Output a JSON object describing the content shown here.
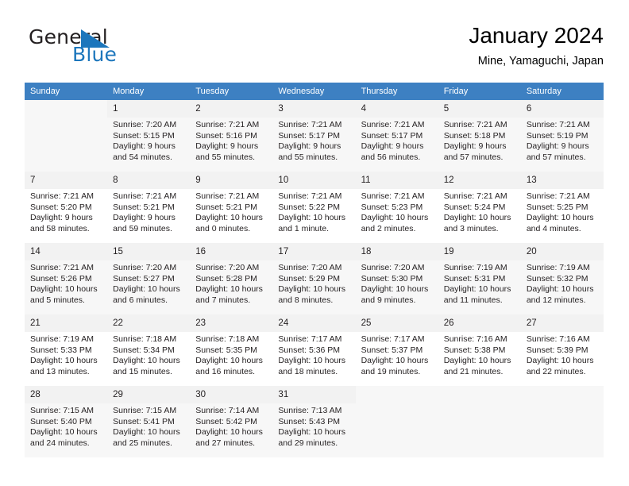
{
  "logo": {
    "primary_text": "General",
    "secondary_text": "Blue",
    "primary_color": "#231f20",
    "secondary_color": "#1c76bc",
    "mark": "triangle-icon"
  },
  "header": {
    "title": "January 2024",
    "subtitle": "Mine, Yamaguchi, Japan"
  },
  "theme": {
    "header_bg": "#3d80c2",
    "header_text": "#ffffff",
    "daynum_bg": "#f2f2f2",
    "row_shade_bg": "#f7f7f7",
    "text": "#231f20"
  },
  "calendar": {
    "weekday_headers": [
      "Sunday",
      "Monday",
      "Tuesday",
      "Wednesday",
      "Thursday",
      "Friday",
      "Saturday"
    ],
    "weeks": [
      [
        {
          "day": "",
          "sunrise": "",
          "sunset": "",
          "daylight": "",
          "daylight2": ""
        },
        {
          "day": "1",
          "sunrise": "Sunrise: 7:20 AM",
          "sunset": "Sunset: 5:15 PM",
          "daylight": "Daylight: 9 hours",
          "daylight2": "and 54 minutes."
        },
        {
          "day": "2",
          "sunrise": "Sunrise: 7:21 AM",
          "sunset": "Sunset: 5:16 PM",
          "daylight": "Daylight: 9 hours",
          "daylight2": "and 55 minutes."
        },
        {
          "day": "3",
          "sunrise": "Sunrise: 7:21 AM",
          "sunset": "Sunset: 5:17 PM",
          "daylight": "Daylight: 9 hours",
          "daylight2": "and 55 minutes."
        },
        {
          "day": "4",
          "sunrise": "Sunrise: 7:21 AM",
          "sunset": "Sunset: 5:17 PM",
          "daylight": "Daylight: 9 hours",
          "daylight2": "and 56 minutes."
        },
        {
          "day": "5",
          "sunrise": "Sunrise: 7:21 AM",
          "sunset": "Sunset: 5:18 PM",
          "daylight": "Daylight: 9 hours",
          "daylight2": "and 57 minutes."
        },
        {
          "day": "6",
          "sunrise": "Sunrise: 7:21 AM",
          "sunset": "Sunset: 5:19 PM",
          "daylight": "Daylight: 9 hours",
          "daylight2": "and 57 minutes."
        }
      ],
      [
        {
          "day": "7",
          "sunrise": "Sunrise: 7:21 AM",
          "sunset": "Sunset: 5:20 PM",
          "daylight": "Daylight: 9 hours",
          "daylight2": "and 58 minutes."
        },
        {
          "day": "8",
          "sunrise": "Sunrise: 7:21 AM",
          "sunset": "Sunset: 5:21 PM",
          "daylight": "Daylight: 9 hours",
          "daylight2": "and 59 minutes."
        },
        {
          "day": "9",
          "sunrise": "Sunrise: 7:21 AM",
          "sunset": "Sunset: 5:21 PM",
          "daylight": "Daylight: 10 hours",
          "daylight2": "and 0 minutes."
        },
        {
          "day": "10",
          "sunrise": "Sunrise: 7:21 AM",
          "sunset": "Sunset: 5:22 PM",
          "daylight": "Daylight: 10 hours",
          "daylight2": "and 1 minute."
        },
        {
          "day": "11",
          "sunrise": "Sunrise: 7:21 AM",
          "sunset": "Sunset: 5:23 PM",
          "daylight": "Daylight: 10 hours",
          "daylight2": "and 2 minutes."
        },
        {
          "day": "12",
          "sunrise": "Sunrise: 7:21 AM",
          "sunset": "Sunset: 5:24 PM",
          "daylight": "Daylight: 10 hours",
          "daylight2": "and 3 minutes."
        },
        {
          "day": "13",
          "sunrise": "Sunrise: 7:21 AM",
          "sunset": "Sunset: 5:25 PM",
          "daylight": "Daylight: 10 hours",
          "daylight2": "and 4 minutes."
        }
      ],
      [
        {
          "day": "14",
          "sunrise": "Sunrise: 7:21 AM",
          "sunset": "Sunset: 5:26 PM",
          "daylight": "Daylight: 10 hours",
          "daylight2": "and 5 minutes."
        },
        {
          "day": "15",
          "sunrise": "Sunrise: 7:20 AM",
          "sunset": "Sunset: 5:27 PM",
          "daylight": "Daylight: 10 hours",
          "daylight2": "and 6 minutes."
        },
        {
          "day": "16",
          "sunrise": "Sunrise: 7:20 AM",
          "sunset": "Sunset: 5:28 PM",
          "daylight": "Daylight: 10 hours",
          "daylight2": "and 7 minutes."
        },
        {
          "day": "17",
          "sunrise": "Sunrise: 7:20 AM",
          "sunset": "Sunset: 5:29 PM",
          "daylight": "Daylight: 10 hours",
          "daylight2": "and 8 minutes."
        },
        {
          "day": "18",
          "sunrise": "Sunrise: 7:20 AM",
          "sunset": "Sunset: 5:30 PM",
          "daylight": "Daylight: 10 hours",
          "daylight2": "and 9 minutes."
        },
        {
          "day": "19",
          "sunrise": "Sunrise: 7:19 AM",
          "sunset": "Sunset: 5:31 PM",
          "daylight": "Daylight: 10 hours",
          "daylight2": "and 11 minutes."
        },
        {
          "day": "20",
          "sunrise": "Sunrise: 7:19 AM",
          "sunset": "Sunset: 5:32 PM",
          "daylight": "Daylight: 10 hours",
          "daylight2": "and 12 minutes."
        }
      ],
      [
        {
          "day": "21",
          "sunrise": "Sunrise: 7:19 AM",
          "sunset": "Sunset: 5:33 PM",
          "daylight": "Daylight: 10 hours",
          "daylight2": "and 13 minutes."
        },
        {
          "day": "22",
          "sunrise": "Sunrise: 7:18 AM",
          "sunset": "Sunset: 5:34 PM",
          "daylight": "Daylight: 10 hours",
          "daylight2": "and 15 minutes."
        },
        {
          "day": "23",
          "sunrise": "Sunrise: 7:18 AM",
          "sunset": "Sunset: 5:35 PM",
          "daylight": "Daylight: 10 hours",
          "daylight2": "and 16 minutes."
        },
        {
          "day": "24",
          "sunrise": "Sunrise: 7:17 AM",
          "sunset": "Sunset: 5:36 PM",
          "daylight": "Daylight: 10 hours",
          "daylight2": "and 18 minutes."
        },
        {
          "day": "25",
          "sunrise": "Sunrise: 7:17 AM",
          "sunset": "Sunset: 5:37 PM",
          "daylight": "Daylight: 10 hours",
          "daylight2": "and 19 minutes."
        },
        {
          "day": "26",
          "sunrise": "Sunrise: 7:16 AM",
          "sunset": "Sunset: 5:38 PM",
          "daylight": "Daylight: 10 hours",
          "daylight2": "and 21 minutes."
        },
        {
          "day": "27",
          "sunrise": "Sunrise: 7:16 AM",
          "sunset": "Sunset: 5:39 PM",
          "daylight": "Daylight: 10 hours",
          "daylight2": "and 22 minutes."
        }
      ],
      [
        {
          "day": "28",
          "sunrise": "Sunrise: 7:15 AM",
          "sunset": "Sunset: 5:40 PM",
          "daylight": "Daylight: 10 hours",
          "daylight2": "and 24 minutes."
        },
        {
          "day": "29",
          "sunrise": "Sunrise: 7:15 AM",
          "sunset": "Sunset: 5:41 PM",
          "daylight": "Daylight: 10 hours",
          "daylight2": "and 25 minutes."
        },
        {
          "day": "30",
          "sunrise": "Sunrise: 7:14 AM",
          "sunset": "Sunset: 5:42 PM",
          "daylight": "Daylight: 10 hours",
          "daylight2": "and 27 minutes."
        },
        {
          "day": "31",
          "sunrise": "Sunrise: 7:13 AM",
          "sunset": "Sunset: 5:43 PM",
          "daylight": "Daylight: 10 hours",
          "daylight2": "and 29 minutes."
        },
        {
          "day": "",
          "sunrise": "",
          "sunset": "",
          "daylight": "",
          "daylight2": ""
        },
        {
          "day": "",
          "sunrise": "",
          "sunset": "",
          "daylight": "",
          "daylight2": ""
        },
        {
          "day": "",
          "sunrise": "",
          "sunset": "",
          "daylight": "",
          "daylight2": ""
        }
      ]
    ]
  }
}
